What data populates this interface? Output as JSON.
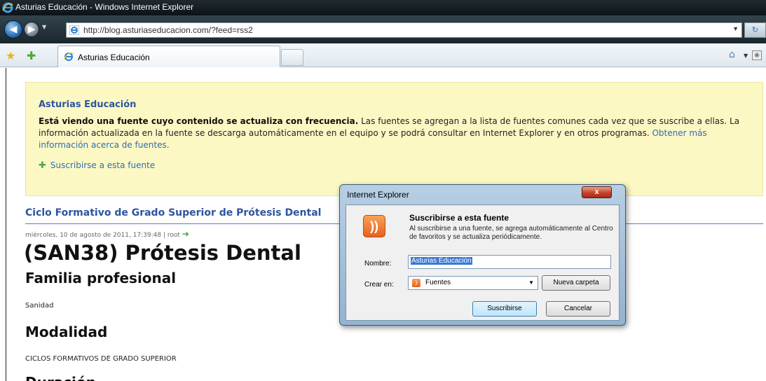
{
  "window": {
    "title": "Asturias Educación - Windows Internet Explorer"
  },
  "address_bar": {
    "url": "http://blog.asturiaseducacion.com/?feed=rss2"
  },
  "tabs": [
    {
      "label": "Asturias Educación"
    }
  ],
  "feed_banner": {
    "title": "Asturias Educación",
    "bold_text": "Está viendo una fuente cuyo contenido se actualiza con frecuencia.",
    "text": " Las fuentes se agregan a la lista de fuentes comunes cada vez que se suscribe a ellas. La información actualizada en la fuente se descarga automáticamente en el equipo y se podrá consultar en Internet Explorer y en otros programas. ",
    "link_text": "Obtener más información acerca de fuentes.",
    "subscribe_link": "Suscribirse a esta fuente"
  },
  "post": {
    "title": "Ciclo Formativo de Grado Superior de Prótesis Dental",
    "meta": "miércoles, 10 de agosto de 2011, 17:39:48 | root",
    "heading": "(SAN38) Prótesis Dental",
    "section1_heading": "Familia profesional",
    "section1_text": "Sanidad",
    "section2_heading": "Modalidad",
    "section2_text": "CICLOS FORMATIVOS DE GRADO SUPERIOR",
    "section3_heading": "Duración"
  },
  "dialog": {
    "title": "Internet Explorer",
    "close_label": "x",
    "heading": "Suscribirse a esta fuente",
    "description": "Al suscribirse a una fuente, se agrega automáticamente al Centro de favoritos y se actualiza periódicamente.",
    "name_label": "Nombre:",
    "name_value": "Asturias Educación",
    "create_label": "Crear en:",
    "create_value": "Fuentes",
    "new_folder_button": "Nueva carpeta",
    "subscribe_button": "Suscribirse",
    "cancel_button": "Cancelar"
  }
}
